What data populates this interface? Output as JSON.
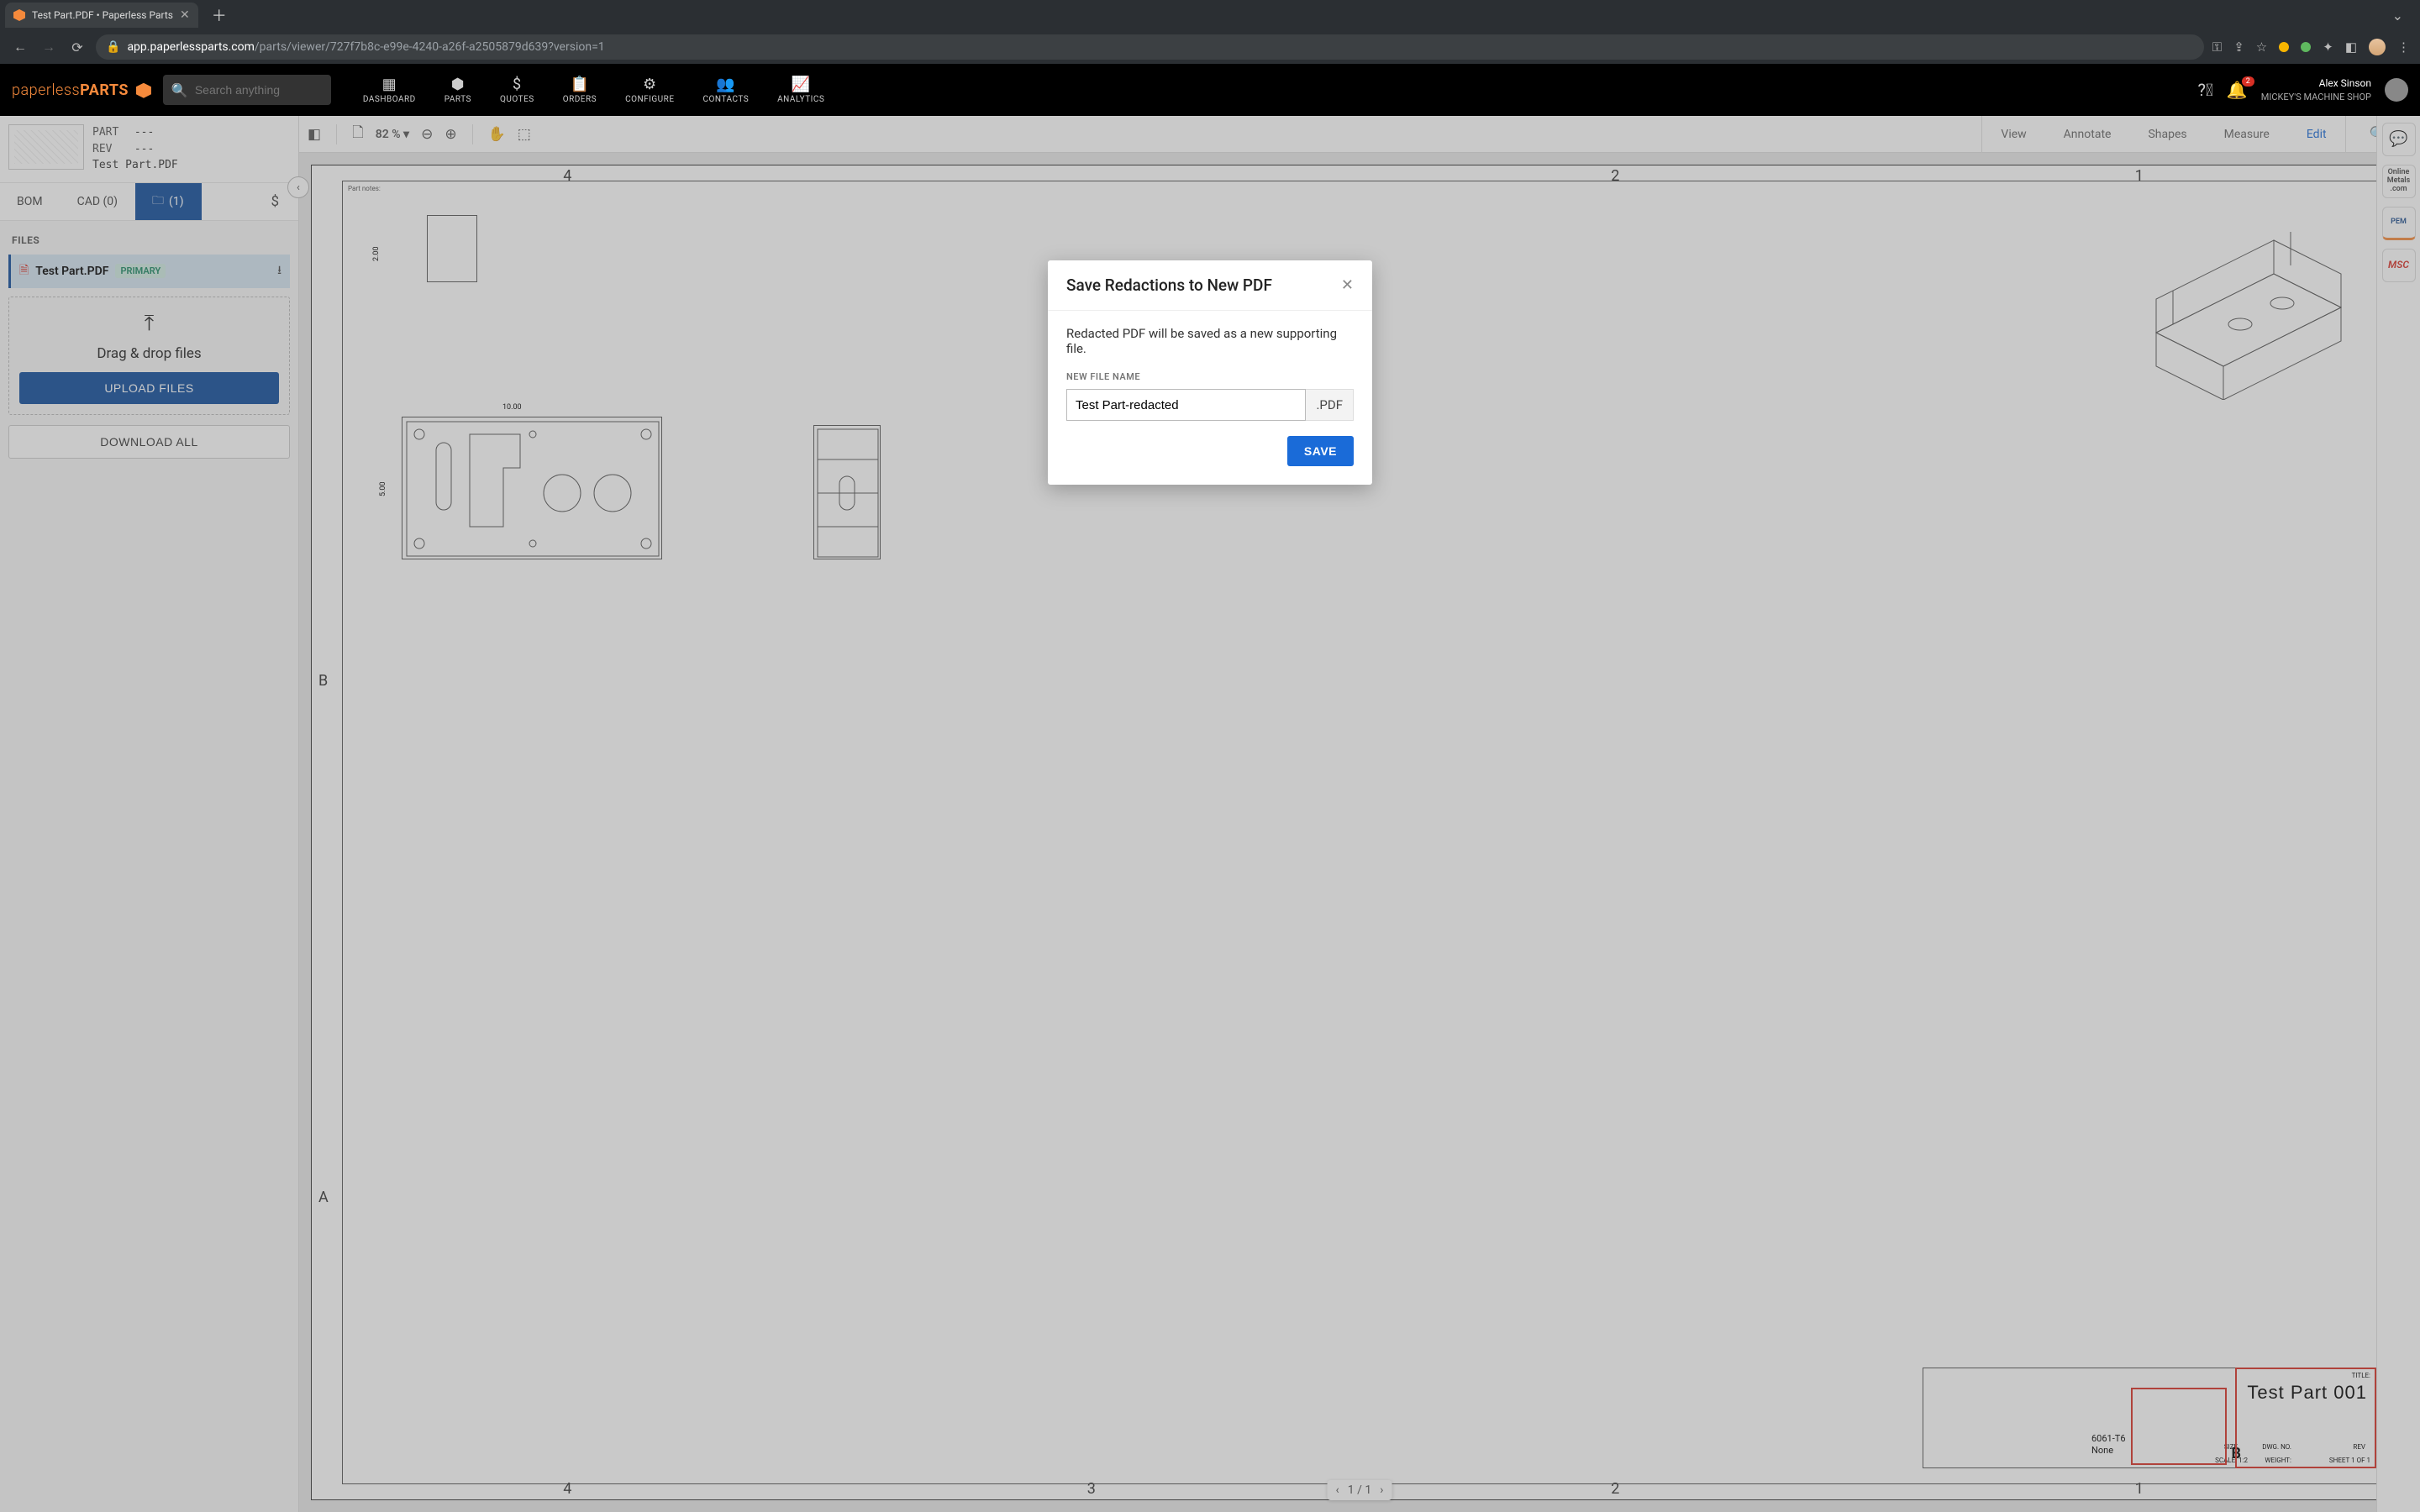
{
  "browser": {
    "tab_title": "Test Part.PDF • Paperless Parts",
    "url_host": "app.paperlessparts.com",
    "url_path": "/parts/viewer/727f7b8c-e99e-4240-a26f-a2505879d639?version=1"
  },
  "header": {
    "brand_light": "paperless",
    "brand_bold": "PARTS",
    "search_placeholder": "Search anything",
    "nav": [
      {
        "label": "DASHBOARD"
      },
      {
        "label": "PARTS"
      },
      {
        "label": "QUOTES"
      },
      {
        "label": "ORDERS"
      },
      {
        "label": "CONFIGURE"
      },
      {
        "label": "CONTACTS"
      },
      {
        "label": "ANALYTICS"
      }
    ],
    "user_name": "Alex Sinson",
    "shop_name": "MICKEY'S MACHINE SHOP",
    "notification_count": "2"
  },
  "part": {
    "part_label": "PART",
    "part_value": "---",
    "rev_label": "REV",
    "rev_value": "---",
    "filename": "Test Part.PDF"
  },
  "subtabs": {
    "bom": "BOM",
    "cad": "CAD (0)",
    "files": "(1)",
    "cost": "$"
  },
  "files": {
    "heading": "FILES",
    "row_name": "Test Part.PDF",
    "primary_badge": "PRIMARY",
    "drop_text": "Drag & drop files",
    "upload_btn": "UPLOAD FILES",
    "download_all": "DOWNLOAD ALL"
  },
  "viewer": {
    "zoom": "82 %",
    "tabs": {
      "view": "View",
      "annotate": "Annotate",
      "shapes": "Shapes",
      "measure": "Measure",
      "edit": "Edit"
    },
    "page_current": "1",
    "page_total": "1"
  },
  "drawing": {
    "title": "Test Part 001",
    "material": "6061-T6",
    "finish": "None",
    "size": "B",
    "scale": "SCALE: 1:2",
    "sheet": "SHEET 1 OF 1",
    "weight_label": "WEIGHT:",
    "title_label": "TITLE:",
    "size_label": "SIZE",
    "dwg_no_label": "DWG. NO.",
    "rev_label": "REV",
    "dims": {
      "w": "10.00",
      "h": "5.00",
      "d": "2.00"
    },
    "corner_letters": {
      "a": "A",
      "b": "B"
    },
    "ruler": {
      "c1": "1",
      "c2": "2",
      "c3": "3",
      "c4": "4"
    },
    "part_notes_label": "Part notes:"
  },
  "right_rail": {
    "online_metals": "Online\nMetals\n.com",
    "pem": "PEM",
    "msc": "MSC"
  },
  "modal": {
    "title": "Save Redactions to New PDF",
    "description": "Redacted PDF will be saved as a new supporting file.",
    "field_label": "NEW FILE NAME",
    "file_name_value": "Test Part-redacted",
    "extension": ".PDF",
    "save_label": "SAVE"
  }
}
